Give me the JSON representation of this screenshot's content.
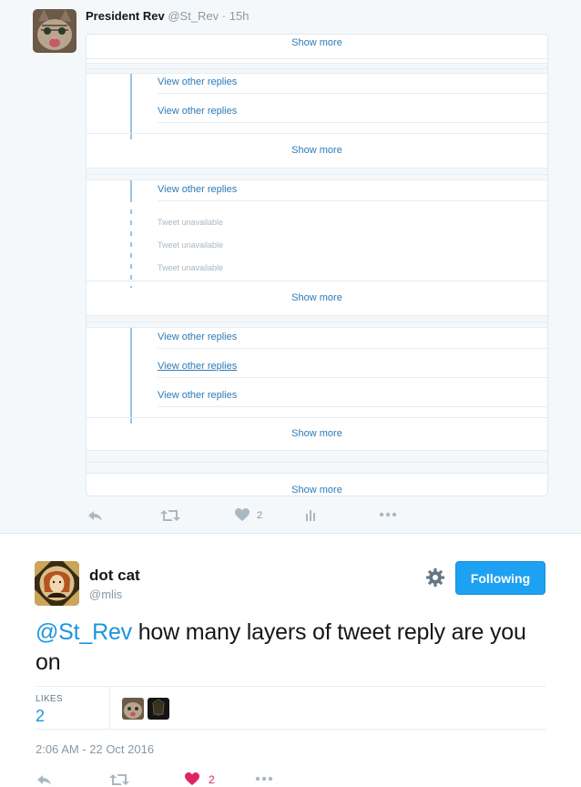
{
  "reply_tweet": {
    "author_name": "President Rev",
    "author_handle": "@St_Rev",
    "separator": "·",
    "time": "15h",
    "thread": {
      "show_more_1": "Show more",
      "group_1": [
        "View other replies",
        "View other replies"
      ],
      "show_more_2": "Show more",
      "group_2_reply": "View other replies",
      "group_2_unavailable": [
        "Tweet unavailable",
        "Tweet unavailable",
        "Tweet unavailable"
      ],
      "show_more_3": "Show more",
      "group_3": [
        "View other replies",
        "View other replies",
        "View other replies"
      ],
      "show_more_4": "Show more",
      "show_more_5": "Show more"
    },
    "actions": {
      "like_count": "2"
    },
    "icons": [
      "reply-icon",
      "retweet-icon",
      "heart-icon",
      "analytics-icon",
      "more-icon"
    ]
  },
  "main_tweet": {
    "author_name": "dot cat",
    "author_handle": "@mlis",
    "follow_label": "Following",
    "mention": "@St_Rev",
    "text": " how many layers of tweet reply are you on",
    "likes_label": "LIKES",
    "likes_count": "2",
    "timestamp": "2:06 AM - 22 Oct 2016",
    "actions": {
      "like_count": "2"
    },
    "icons": [
      "gear-icon",
      "reply-icon",
      "retweet-icon",
      "heart-icon",
      "more-icon"
    ]
  },
  "colors": {
    "accent": "#1da1f2",
    "link": "#2b7bb9",
    "muted": "#8899a6",
    "like": "#e0245e",
    "thread_line": "#9cc2e5"
  }
}
